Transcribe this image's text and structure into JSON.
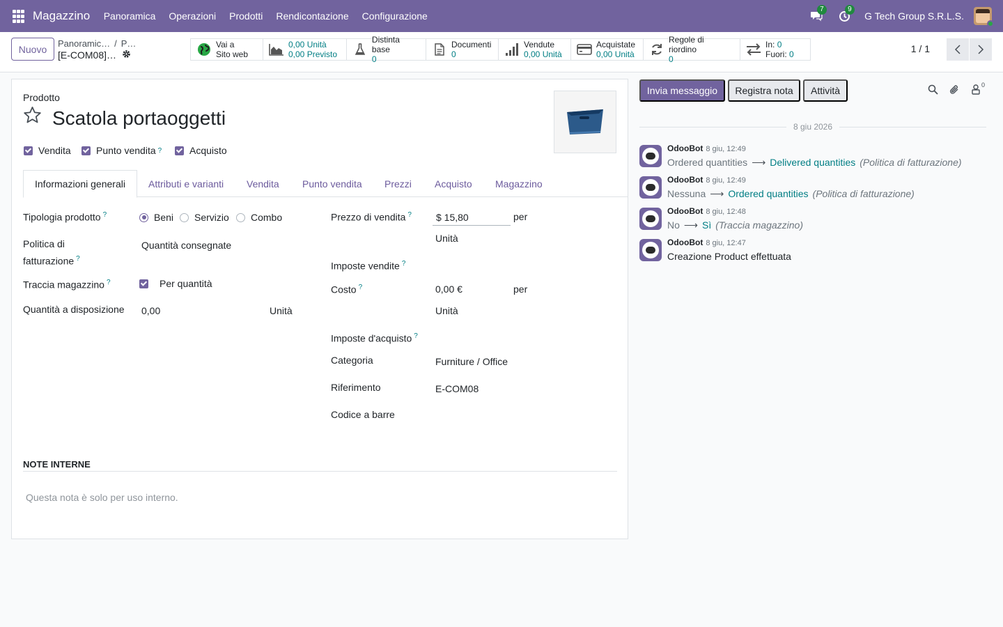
{
  "navbar": {
    "app_name": "Magazzino",
    "menu": [
      "Panoramica",
      "Operazioni",
      "Prodotti",
      "Rendicontazione",
      "Configurazione"
    ],
    "messages_badge": "7",
    "activities_badge": "9",
    "company": "G Tech Group S.R.L.S."
  },
  "control": {
    "new_button": "Nuovo",
    "breadcrumb_1": "Panoramic…",
    "breadcrumb_sep": "/",
    "breadcrumb_2": "P…",
    "record_title": "[E-COM08]…",
    "smart_buttons": {
      "website": {
        "line1": "Vai a",
        "line2": "Sito web"
      },
      "forecast": {
        "on_hand": "0,00 Unità",
        "forecasted": "0,00 Previsto"
      },
      "bom": {
        "label": "Distinta base",
        "value": "0"
      },
      "documents": {
        "label": "Documenti",
        "value": "0"
      },
      "sold": {
        "label": "Vendute",
        "value": "0,00 Unità"
      },
      "purchased": {
        "label": "Acquistate",
        "value": "0,00 Unità"
      },
      "reorder": {
        "label": "Regole di riordino",
        "value": "0"
      },
      "moves": {
        "in_label": "In:",
        "in_value": "0",
        "out_label": "Fuori:",
        "out_value": "0"
      }
    },
    "pager": "1 / 1"
  },
  "form": {
    "product_label": "Prodotto",
    "product_name": "Scatola portaoggetti",
    "checkboxes": {
      "sale": "Vendita",
      "pos": "Punto vendita",
      "purchase": "Acquisto"
    },
    "help_mark": "?",
    "tabs": [
      "Informazioni generali",
      "Attributi e varianti",
      "Vendita",
      "Punto vendita",
      "Prezzi",
      "Acquisto",
      "Magazzino"
    ],
    "left": {
      "type_label": "Tipologia prodotto",
      "type_options": [
        "Beni",
        "Servizio",
        "Combo"
      ],
      "type_selected": "Beni",
      "invoice_policy_label_1": "Politica di",
      "invoice_policy_label_2": "fatturazione",
      "invoice_policy_value": "Quantità consegnate",
      "track_label": "Traccia magazzino",
      "track_value": "Per quantità",
      "qty_label": "Quantità a disposizione",
      "qty_value": "0,00",
      "qty_uom": "Unità"
    },
    "right": {
      "sale_price_label": "Prezzo di vendita",
      "sale_price_value": "$ 15,80",
      "per": "per",
      "uom": "Unità",
      "sale_taxes_label": "Imposte vendite",
      "cost_label": "Costo",
      "cost_value": "0,00 €",
      "purchase_taxes_label": "Imposte d'acquisto",
      "category_label": "Categoria",
      "category_value": "Furniture / Office",
      "reference_label": "Riferimento",
      "reference_value": "E-COM08",
      "barcode_label": "Codice a barre"
    },
    "notes_title": "NOTE INTERNE",
    "notes_placeholder": "Questa nota è solo per uso interno."
  },
  "chatter": {
    "send_message": "Invia messaggio",
    "log_note": "Registra nota",
    "activities": "Attività",
    "followers_count": "0",
    "date_separator": "8 giu 2026",
    "messages": [
      {
        "author": "OdooBot",
        "time": "8 giu, 12:49",
        "old": "Ordered quantities",
        "new": "Delivered quantities",
        "field": "(Politica di fatturazione)"
      },
      {
        "author": "OdooBot",
        "time": "8 giu, 12:49",
        "old": "Nessuna",
        "new": "Ordered quantities",
        "field": "(Politica di fatturazione)"
      },
      {
        "author": "OdooBot",
        "time": "8 giu, 12:48",
        "old": "No",
        "new": "Sì",
        "field": "(Traccia magazzino)"
      },
      {
        "author": "OdooBot",
        "time": "8 giu, 12:47",
        "body": "Creazione Product effettuata"
      }
    ]
  },
  "colors": {
    "brand": "#71639e",
    "link": "#017e84",
    "badge": "#20893f"
  },
  "icons": [
    "apps-grid-icon",
    "chat-icon",
    "clock-icon",
    "globe-icon",
    "area-chart-icon",
    "flask-icon",
    "file-icon",
    "signal-icon",
    "credit-card-icon",
    "refresh-icon",
    "exchange-icon",
    "gear-icon",
    "star-icon",
    "search-icon",
    "paperclip-icon",
    "user-lock-icon",
    "chevron-left-icon",
    "chevron-right-icon"
  ]
}
